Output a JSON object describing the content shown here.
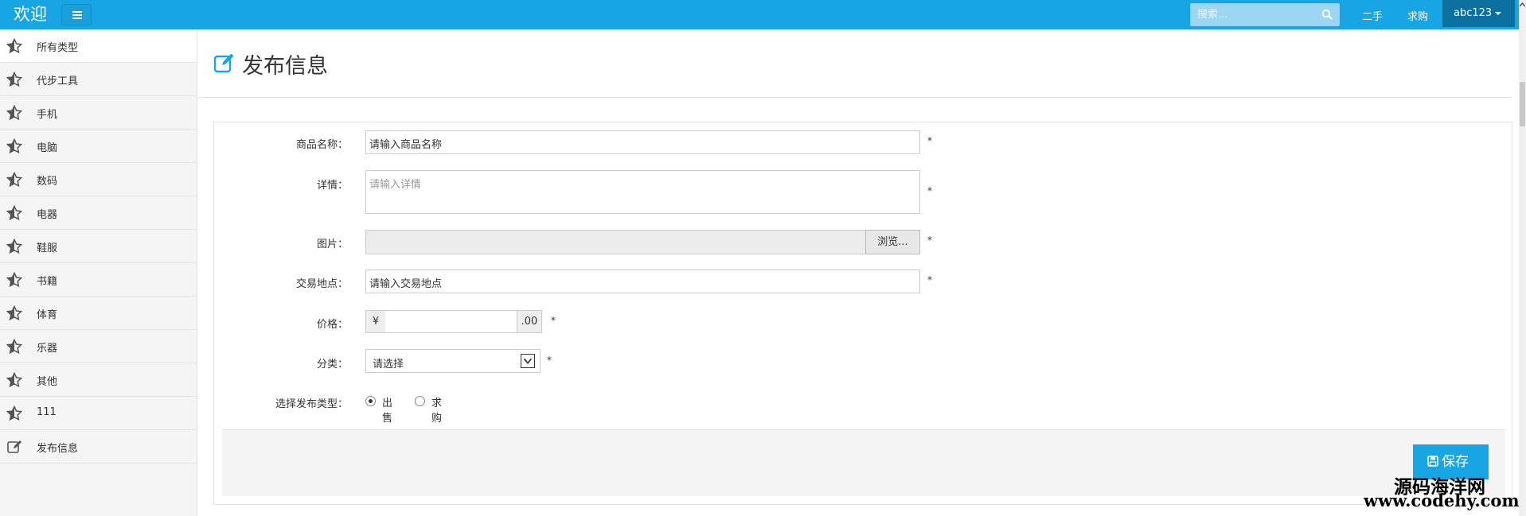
{
  "topbar": {
    "brand": "欢迎",
    "search_placeholder": "搜索...",
    "links": [
      "二手",
      "求购"
    ],
    "user": "abc123"
  },
  "sidebar": {
    "items": [
      {
        "label": "所有类型",
        "icon": "star-icon"
      },
      {
        "label": "代步工具",
        "icon": "star-icon"
      },
      {
        "label": "手机",
        "icon": "star-icon"
      },
      {
        "label": "电脑",
        "icon": "star-icon"
      },
      {
        "label": "数码",
        "icon": "star-icon"
      },
      {
        "label": "电器",
        "icon": "star-icon"
      },
      {
        "label": "鞋服",
        "icon": "star-icon"
      },
      {
        "label": "书籍",
        "icon": "star-icon"
      },
      {
        "label": "体育",
        "icon": "star-icon"
      },
      {
        "label": "乐器",
        "icon": "star-icon"
      },
      {
        "label": "其他",
        "icon": "star-icon"
      },
      {
        "label": "111",
        "icon": "star-icon"
      },
      {
        "label": "发布信息",
        "icon": "edit-icon"
      }
    ]
  },
  "page": {
    "title": "发布信息"
  },
  "form": {
    "name_label": "商品名称：",
    "name_value": "请输入商品名称",
    "detail_label": "详情：",
    "detail_placeholder": "请输入详情",
    "image_label": "图片：",
    "browse_label": "浏览...",
    "location_label": "交易地点：",
    "location_value": "请输入交易地点",
    "price_label": "价格：",
    "price_prefix": "¥",
    "price_suffix": ".00",
    "category_label": "分类：",
    "category_value": "请选择",
    "type_label": "选择发布类型：",
    "type_options": [
      "出售",
      "求购"
    ],
    "required_mark": "*",
    "save_label": "保存"
  },
  "watermark": {
    "line1": "源码海洋网",
    "line2": "www.codehy.com"
  },
  "colors": {
    "topbar": "#17a6e3",
    "user_menu": "#0b6fa0",
    "save_button": "#17a6e3"
  }
}
